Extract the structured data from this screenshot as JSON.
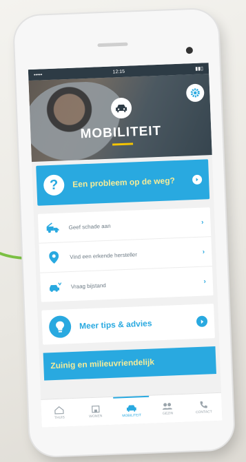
{
  "status_bar": {
    "carrier": "•••••",
    "time": "12:15",
    "battery": "▮▮▯"
  },
  "hero": {
    "title": "MOBILITEIT",
    "car_icon": "car-icon",
    "settings_icon": "gear-icon"
  },
  "problem_card": {
    "icon": "question-icon",
    "text": "Een probleem op de weg?"
  },
  "menu_items": [
    {
      "icon": "tow-truck-icon",
      "label": "Geef schade aan"
    },
    {
      "icon": "location-pin-icon",
      "label": "Vind een erkende hersteller"
    },
    {
      "icon": "car-crash-icon",
      "label": "Vraag bijstand"
    }
  ],
  "tips_card": {
    "icon": "lightbulb-icon",
    "text": "Meer tips & advies"
  },
  "promo_banner": {
    "text": "Zuinig en milieuvriendelijk"
  },
  "tab_bar": [
    {
      "icon": "home-icon",
      "label": "THUIS"
    },
    {
      "icon": "building-icon",
      "label": "WONEN"
    },
    {
      "icon": "car-icon",
      "label": "MOBILITEIT",
      "active": true
    },
    {
      "icon": "people-icon",
      "label": "GEZIN"
    },
    {
      "icon": "phone-icon",
      "label": "CONTACT"
    }
  ],
  "colors": {
    "primary": "#29a9e0",
    "accent_text": "#f4ec9a",
    "underline": "#f5c400",
    "annotation_arrow": "#7bc043"
  }
}
